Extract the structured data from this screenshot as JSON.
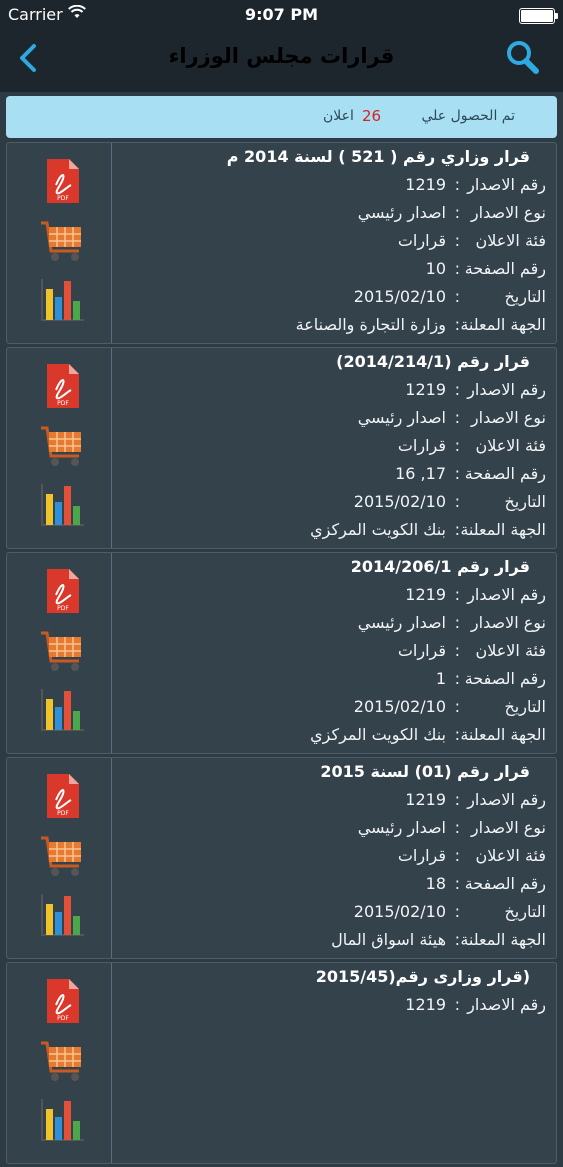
{
  "status": {
    "carrier": "Carrier",
    "time": "9:07 PM"
  },
  "nav": {
    "title": "قرارات مجلس الوزراء"
  },
  "banner": {
    "label": "تم الحصول علي",
    "count": "26",
    "unit": "اعلان"
  },
  "field_labels": {
    "issue_no": "رقم الاصدار",
    "issue_type": "نوع الاصدار",
    "category": "فئة الاعلان",
    "page": "رقم الصفحة",
    "date": "التاريخ",
    "authority": "الجهة المعلنة"
  },
  "items": [
    {
      "title": "قرار وزاري رقم (     521  )  لسنة 2014 م",
      "issue_no": "1219",
      "issue_type": "اصدار رئيسي",
      "category": "قرارات",
      "page": "10",
      "date": "2015/02/10",
      "authority": "وزارة التجارة والصناعة"
    },
    {
      "title": "قرار رقم (2014/214/1)",
      "issue_no": "1219",
      "issue_type": "اصدار رئيسي",
      "category": "قرارات",
      "page": "17, 16",
      "date": "2015/02/10",
      "authority": "بنك الكويت المركزي"
    },
    {
      "title": "قرار رقم 2014/206/1",
      "issue_no": "1219",
      "issue_type": "اصدار رئيسي",
      "category": "قرارات",
      "page": "1",
      "date": "2015/02/10",
      "authority": "بنك الكويت المركزي"
    },
    {
      "title": "قرار رقم (01) لسنة 2015",
      "issue_no": "1219",
      "issue_type": "اصدار رئيسي",
      "category": "قرارات",
      "page": "18",
      "date": "2015/02/10",
      "authority": "هيئة اسواق المال"
    },
    {
      "title": "(قرار وزارى رقم(2015/45",
      "issue_no": "1219",
      "issue_type": "",
      "category": "",
      "page": "",
      "date": "",
      "authority": ""
    }
  ],
  "icons": {
    "back": "chevron-left-icon",
    "search": "search-icon",
    "pdf": "pdf-icon",
    "cart": "cart-icon",
    "chart": "bar-chart-icon"
  }
}
